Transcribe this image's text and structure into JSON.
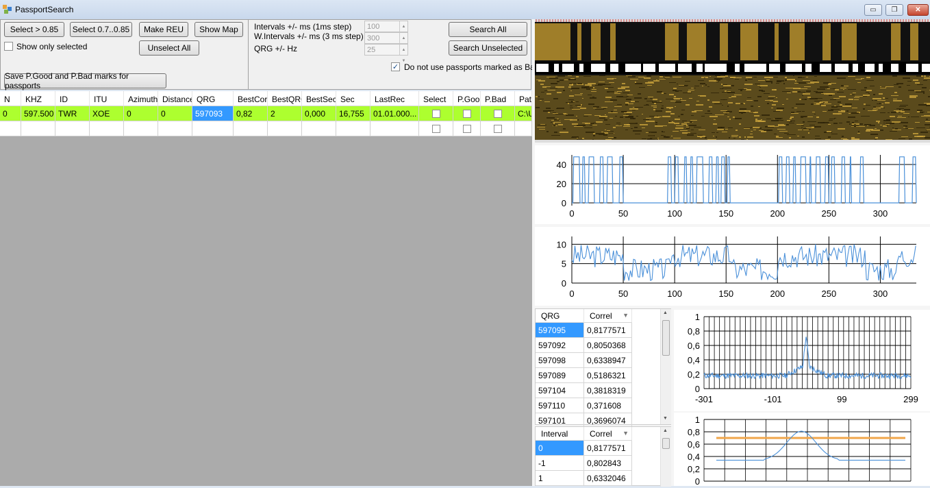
{
  "window": {
    "title": "PassportSearch",
    "min_label": "▭",
    "max_label": "❐",
    "close_label": "✕"
  },
  "toolbar": {
    "select_085": "Select > 0.85",
    "select_range": "Select 0.7..0.85",
    "make_reu": "Make REU",
    "show_map": "Show Map",
    "show_only_selected": "Show only selected",
    "unselect_all": "Unselect All",
    "save_marks": "Save P.Good and P.Bad marks for passports"
  },
  "params": {
    "intervals_label": "Intervals +/- ms (1ms step)",
    "wintervals_label": "W.Intervals +/- ms (3 ms step)",
    "qrg_label": "QRG +/- Hz",
    "intervals_value": "100",
    "wintervals_value": "300",
    "qrg_value": "25",
    "search_all": "Search All",
    "search_unselected": "Search Unselected",
    "do_not_use_bad": "Do not use passports marked as Bad",
    "do_not_use_bad_checked": true
  },
  "grid": {
    "columns": [
      "N",
      "KHZ",
      "ID",
      "ITU",
      "Azimuth",
      "Distance",
      "QRG",
      "BestCorr",
      "BestQRG",
      "BestSec",
      "Sec",
      "LastRec",
      "Select",
      "P.Good",
      "P.Bad",
      "Path"
    ],
    "rows": [
      {
        "N": "0",
        "KHZ": "597.500",
        "ID": "TWR",
        "ITU": "XOE",
        "Azimuth": "0",
        "Distance": "0",
        "QRG": "597093",
        "BestCorr": "0,82",
        "BestQRG": "2",
        "BestSec": "0,000",
        "Sec": "16,755",
        "LastRec": "01.01.000...",
        "Path": "C:\\U"
      }
    ],
    "row_colors": {
      "selected": "#adff2f",
      "qrg_cell": "#3399ff"
    }
  },
  "qrg_table": {
    "headers": [
      "QRG",
      "Correl"
    ],
    "rows": [
      [
        "597095",
        "0,8177571"
      ],
      [
        "597092",
        "0,8050368"
      ],
      [
        "597098",
        "0,6338947"
      ],
      [
        "597089",
        "0,5186321"
      ],
      [
        "597104",
        "0,3818319"
      ],
      [
        "597110",
        "0,371608"
      ],
      [
        "597101",
        "0,3696074"
      ]
    ]
  },
  "interval_table": {
    "headers": [
      "Interval",
      "Correl"
    ],
    "rows": [
      [
        "0",
        "0,8177571"
      ],
      [
        "-1",
        "0,802843"
      ],
      [
        "1",
        "0,6332046"
      ]
    ]
  },
  "chart_data": [
    {
      "type": "line",
      "yticks": [
        "40",
        "20",
        "0"
      ],
      "xticks": [
        "0",
        "50",
        "100",
        "150",
        "200",
        "250",
        "300"
      ],
      "xlim": [
        0,
        335
      ],
      "ylim": [
        0,
        50
      ],
      "color": "#4a90d9"
    },
    {
      "type": "line",
      "yticks": [
        "10",
        "5",
        "0"
      ],
      "xticks": [
        "0",
        "50",
        "100",
        "150",
        "200",
        "250",
        "300"
      ],
      "xlim": [
        0,
        335
      ],
      "ylim": [
        0,
        12
      ],
      "color": "#4a90d9"
    },
    {
      "type": "line",
      "yticks": [
        "1",
        "0,8",
        "0,6",
        "0,4",
        "0,2",
        "0"
      ],
      "xticks": [
        "-301",
        "-101",
        "99",
        "299"
      ],
      "xlim": [
        -301,
        299
      ],
      "ylim": [
        0,
        1
      ],
      "color": "#4a90d9"
    },
    {
      "type": "line",
      "yticks": [
        "1",
        "0,8",
        "0,6",
        "0,4",
        "0,2",
        "0"
      ],
      "ylim": [
        0,
        1
      ],
      "threshold": 0.7,
      "threshold_color": "#f0a64a",
      "color": "#4a90d9"
    }
  ]
}
